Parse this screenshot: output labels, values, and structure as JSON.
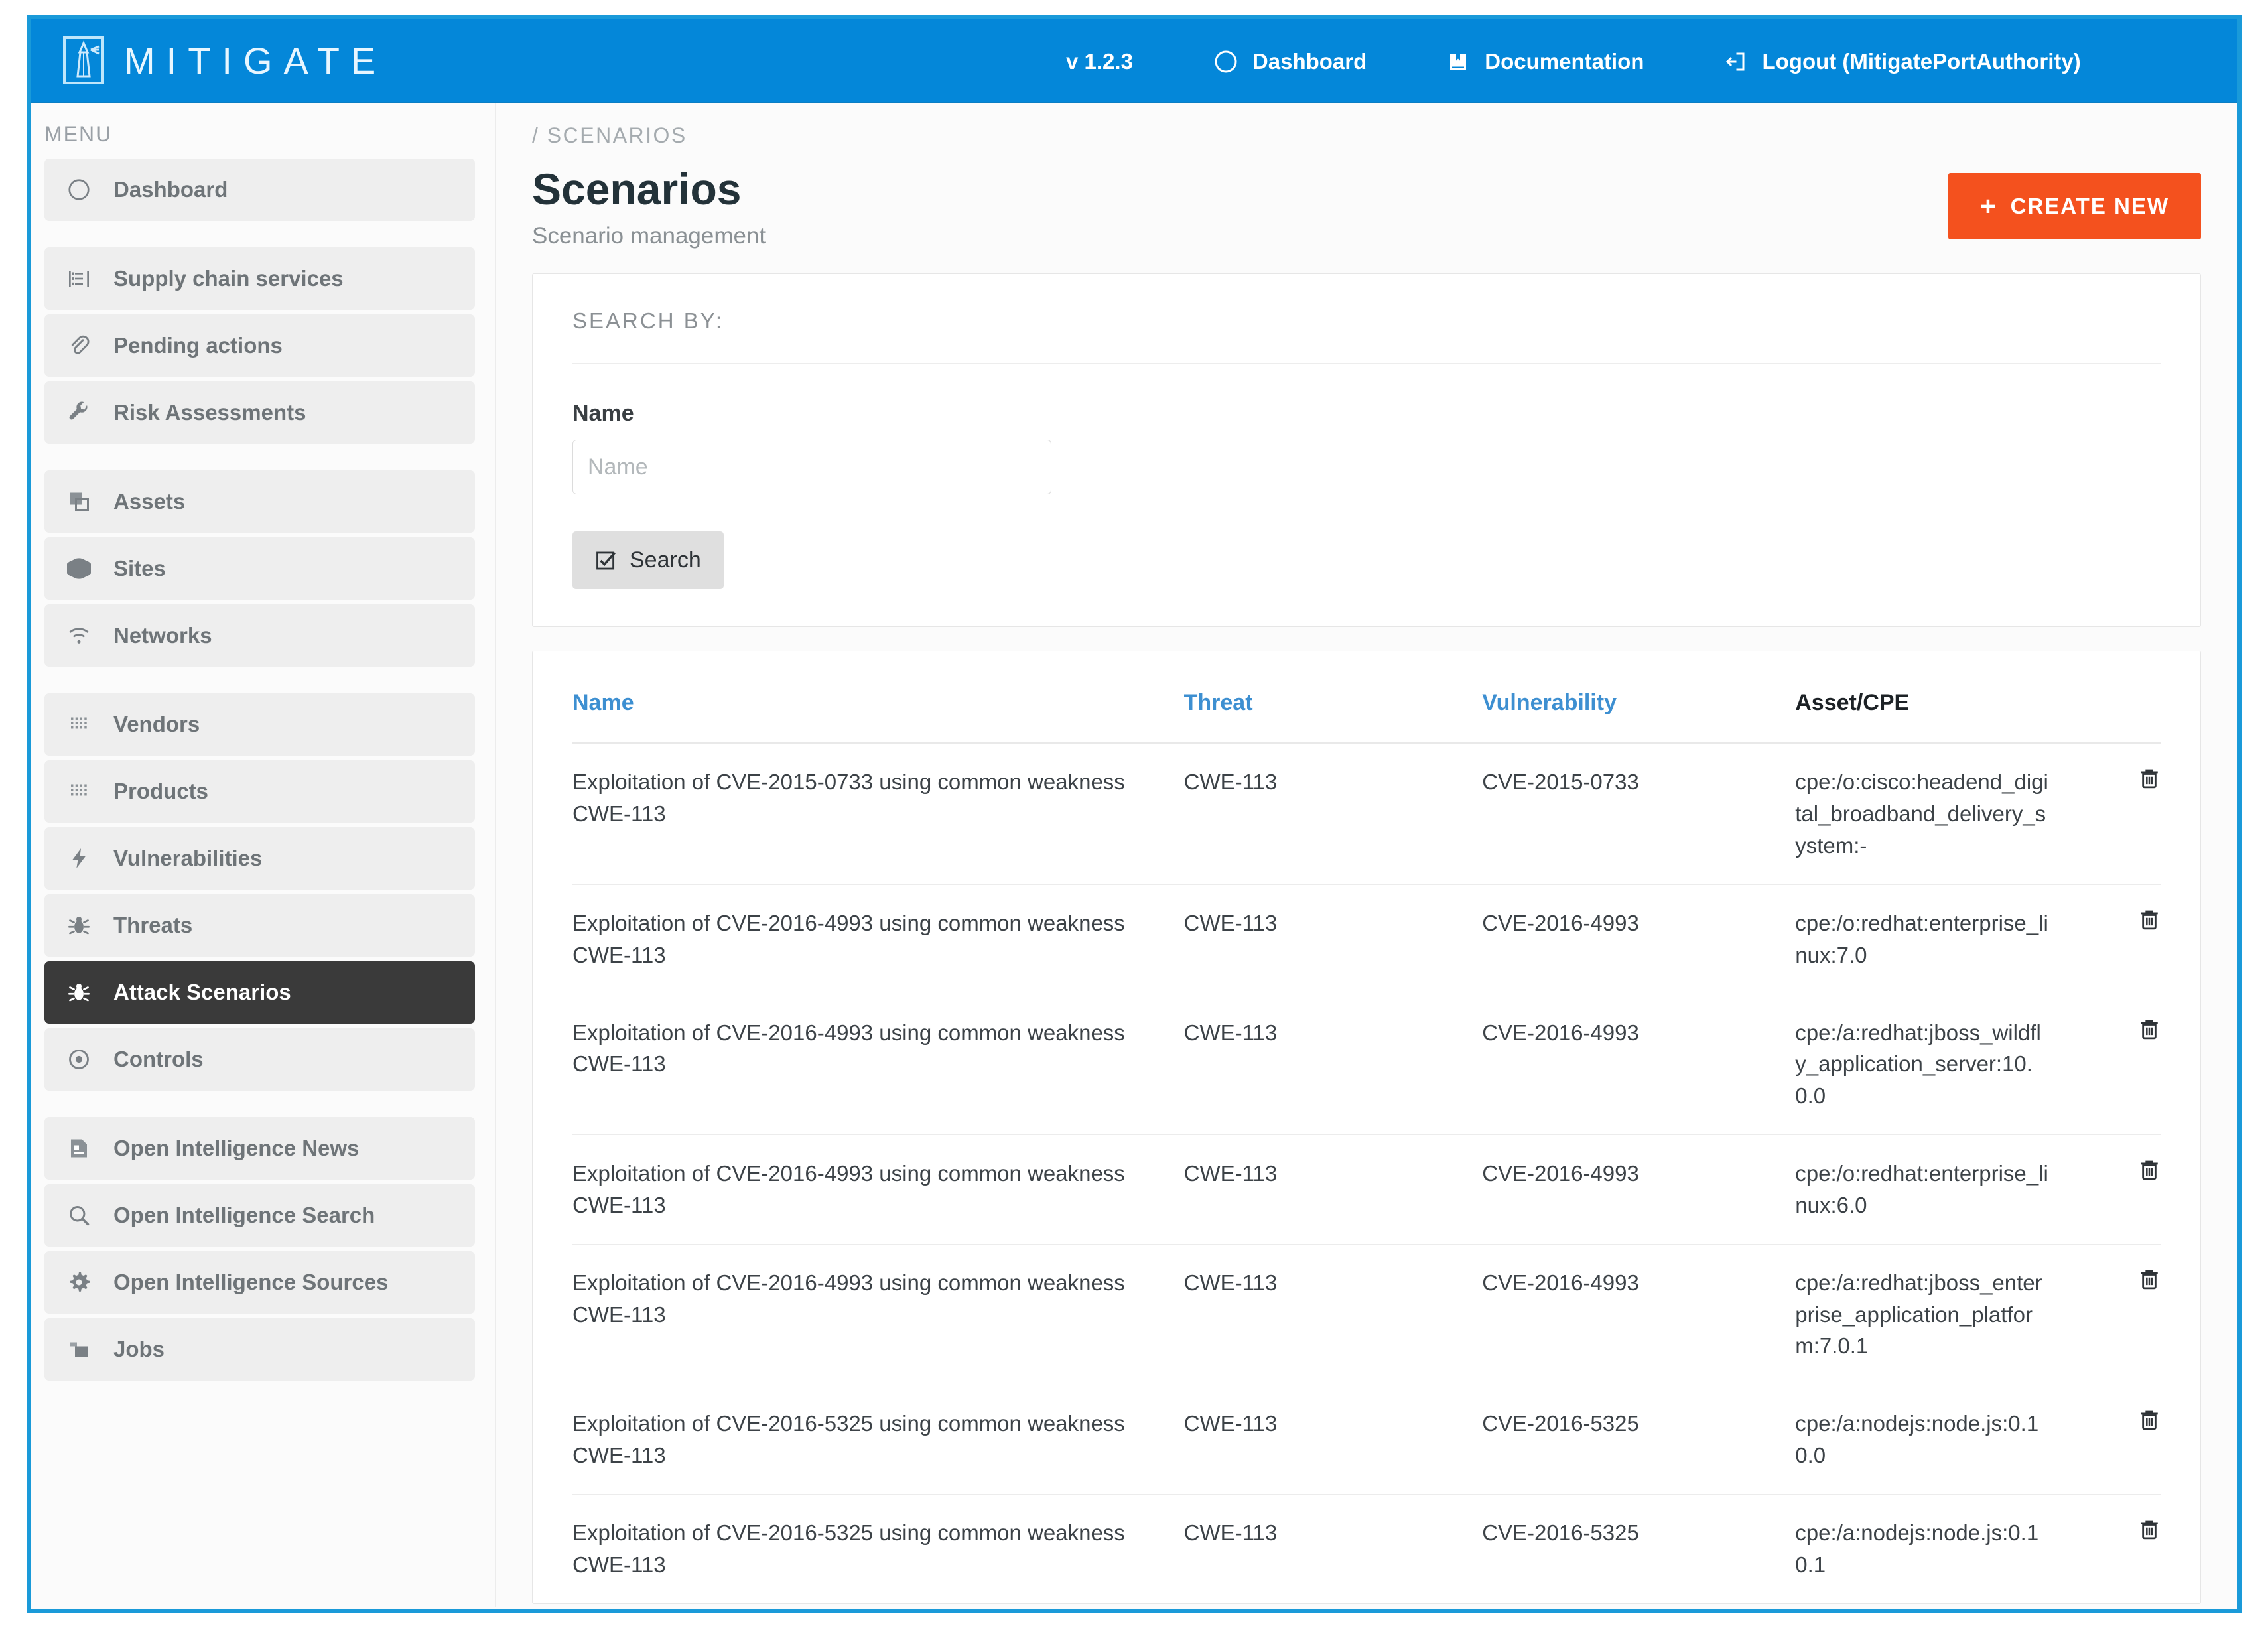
{
  "brand": {
    "name": "MITIGATE",
    "logo_icon": "lighthouse-icon"
  },
  "topnav": {
    "version": "v 1.2.3",
    "items": [
      {
        "label": "Dashboard",
        "icon": "compass-icon"
      },
      {
        "label": "Documentation",
        "icon": "book-icon"
      },
      {
        "label": "Logout (MitigatePortAuthority)",
        "icon": "logout-icon"
      }
    ]
  },
  "sidebar": {
    "menu_label": "MENU",
    "groups": [
      {
        "items": [
          {
            "label": "Dashboard",
            "icon": "compass-icon",
            "active": false
          }
        ]
      },
      {
        "items": [
          {
            "label": "Supply chain services",
            "icon": "supply-chain-icon",
            "active": false
          },
          {
            "label": "Pending actions",
            "icon": "paperclip-icon",
            "active": false
          },
          {
            "label": "Risk Assessments",
            "icon": "wrench-icon",
            "active": false
          }
        ]
      },
      {
        "items": [
          {
            "label": "Assets",
            "icon": "layers-icon",
            "active": false
          },
          {
            "label": "Sites",
            "icon": "globe-icon",
            "active": false
          },
          {
            "label": "Networks",
            "icon": "wifi-icon",
            "active": false
          }
        ]
      },
      {
        "items": [
          {
            "label": "Vendors",
            "icon": "grid-dots-icon",
            "active": false
          },
          {
            "label": "Products",
            "icon": "grid-dots-icon",
            "active": false
          },
          {
            "label": "Vulnerabilities",
            "icon": "bolt-icon",
            "active": false
          },
          {
            "label": "Threats",
            "icon": "bug-icon",
            "active": false
          },
          {
            "label": "Attack Scenarios",
            "icon": "bug-icon",
            "active": true
          },
          {
            "label": "Controls",
            "icon": "eye-icon",
            "active": false
          }
        ]
      },
      {
        "items": [
          {
            "label": "Open Intelligence News",
            "icon": "news-icon",
            "active": false
          },
          {
            "label": "Open Intelligence Search",
            "icon": "search-icon",
            "active": false
          },
          {
            "label": "Open Intelligence Sources",
            "icon": "gear-icon",
            "active": false
          },
          {
            "label": "Jobs",
            "icon": "jobs-icon",
            "active": false
          }
        ]
      }
    ]
  },
  "page": {
    "breadcrumb": "/ SCENARIOS",
    "title": "Scenarios",
    "subtitle": "Scenario management",
    "create_button": "CREATE NEW"
  },
  "search": {
    "heading": "SEARCH BY:",
    "name_label": "Name",
    "name_value": "",
    "name_placeholder": "Name",
    "search_button": "Search"
  },
  "table": {
    "headers": {
      "name": "Name",
      "threat": "Threat",
      "vulnerability": "Vulnerability",
      "asset_cpe": "Asset/CPE"
    },
    "rows": [
      {
        "name": "Exploitation of CVE-2015-0733 using common weakness CWE-113",
        "threat": "CWE-113",
        "vulnerability": "CVE-2015-0733",
        "asset_cpe": "cpe:/o:cisco:headend_digital_broadband_delivery_system:-",
        "delete_icon": "trash-icon"
      },
      {
        "name": "Exploitation of CVE-2016-4993 using common weakness CWE-113",
        "threat": "CWE-113",
        "vulnerability": "CVE-2016-4993",
        "asset_cpe": "cpe:/o:redhat:enterprise_linux:7.0",
        "delete_icon": "trash-icon"
      },
      {
        "name": "Exploitation of CVE-2016-4993 using common weakness CWE-113",
        "threat": "CWE-113",
        "vulnerability": "CVE-2016-4993",
        "asset_cpe": "cpe:/a:redhat:jboss_wildfly_application_server:10.0.0",
        "delete_icon": "trash-icon"
      },
      {
        "name": "Exploitation of CVE-2016-4993 using common weakness CWE-113",
        "threat": "CWE-113",
        "vulnerability": "CVE-2016-4993",
        "asset_cpe": "cpe:/o:redhat:enterprise_linux:6.0",
        "delete_icon": "trash-icon"
      },
      {
        "name": "Exploitation of CVE-2016-4993 using common weakness CWE-113",
        "threat": "CWE-113",
        "vulnerability": "CVE-2016-4993",
        "asset_cpe": "cpe:/a:redhat:jboss_enterprise_application_platform:7.0.1",
        "delete_icon": "trash-icon"
      },
      {
        "name": "Exploitation of CVE-2016-5325 using common weakness CWE-113",
        "threat": "CWE-113",
        "vulnerability": "CVE-2016-5325",
        "asset_cpe": "cpe:/a:nodejs:node.js:0.10.0",
        "delete_icon": "trash-icon"
      },
      {
        "name": "Exploitation of CVE-2016-5325 using common weakness CWE-113",
        "threat": "CWE-113",
        "vulnerability": "CVE-2016-5325",
        "asset_cpe": "cpe:/a:nodejs:node.js:0.10.1",
        "delete_icon": "trash-icon"
      }
    ]
  },
  "colors": {
    "brand_blue": "#0487d9",
    "accent_orange": "#f4511e",
    "active_item": "#3a3a3a",
    "link_blue": "#3d8fd1",
    "icon_gray": "#7a8085"
  }
}
